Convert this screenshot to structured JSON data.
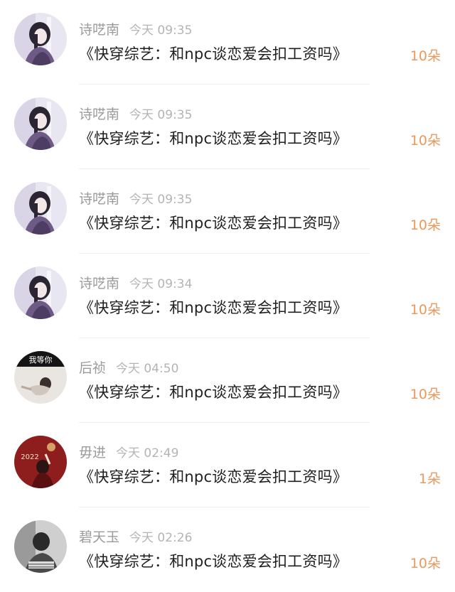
{
  "gifts": [
    {
      "user": "诗呓南",
      "time": "今天 09:35",
      "book": "《快穿综艺：和npc谈恋爱会扣工资吗》",
      "amount": "10朵",
      "avatar": "anime-girl-avatar"
    },
    {
      "user": "诗呓南",
      "time": "今天 09:35",
      "book": "《快穿综艺：和npc谈恋爱会扣工资吗》",
      "amount": "10朵",
      "avatar": "anime-girl-avatar"
    },
    {
      "user": "诗呓南",
      "time": "今天 09:35",
      "book": "《快穿综艺：和npc谈恋爱会扣工资吗》",
      "amount": "10朵",
      "avatar": "anime-girl-avatar"
    },
    {
      "user": "诗呓南",
      "time": "今天 09:34",
      "book": "《快穿综艺：和npc谈恋爱会扣工资吗》",
      "amount": "10朵",
      "avatar": "anime-girl-avatar"
    },
    {
      "user": "后祯",
      "time": "今天 04:50",
      "book": "《快穿综艺：和npc谈恋爱会扣工资吗》",
      "amount": "10朵",
      "avatar": "waiting-photo-avatar",
      "avatar_text": "我等你"
    },
    {
      "user": "毋进",
      "time": "今天 02:49",
      "book": "《快穿综艺：和npc谈恋爱会扣工资吗》",
      "amount": "1朵",
      "avatar": "new-year-2022-avatar",
      "avatar_text": "2022"
    },
    {
      "user": "碧天玉",
      "time": "今天 02:26",
      "book": "《快穿综艺：和npc谈恋爱会扣工资吗》",
      "amount": "10朵",
      "avatar": "bw-photo-avatar"
    }
  ],
  "colors": {
    "amount": "#e89a5e",
    "name": "#9b9b9b",
    "time": "#b4b4b4",
    "title": "#1f1f1f"
  }
}
